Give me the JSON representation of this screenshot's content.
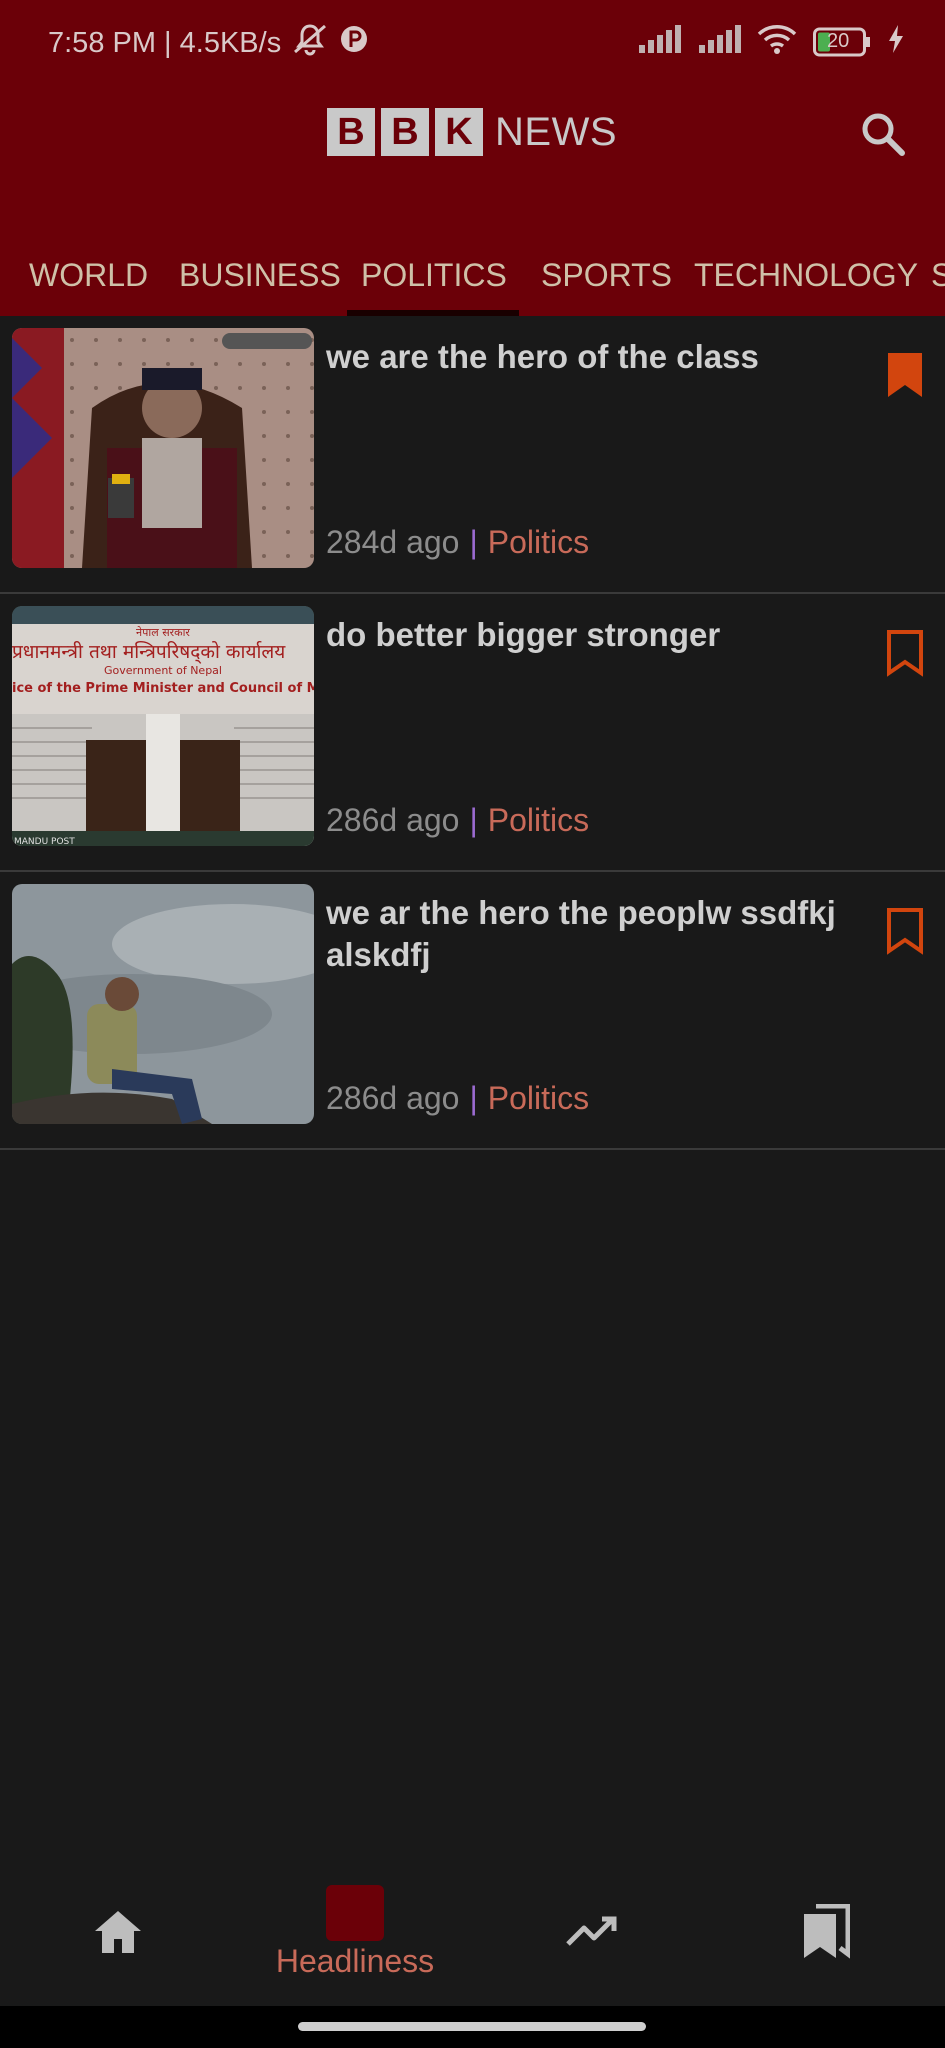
{
  "status_bar": {
    "time": "7:58 PM | 4.5KB/s",
    "battery": "20"
  },
  "header": {
    "brand_letters": [
      "B",
      "B",
      "K"
    ],
    "brand_word": "NEWS",
    "search_icon": "search-icon"
  },
  "tabs": [
    {
      "label": "WORLD"
    },
    {
      "label": "BUSINESS"
    },
    {
      "label": "POLITICS",
      "selected": true
    },
    {
      "label": "SPORTS"
    },
    {
      "label": "TECHNOLOGY"
    },
    {
      "label": "S"
    }
  ],
  "articles": [
    {
      "title": "we are the hero of the class",
      "age": "284d ago",
      "separator": "|",
      "category": "Politics",
      "bookmarked": true
    },
    {
      "title": "do better bigger stronger",
      "age": "286d ago",
      "separator": "|",
      "category": "Politics",
      "bookmarked": false
    },
    {
      "title": "we ar the hero the peoplw ssdfkj alskdfj",
      "age": "286d ago",
      "separator": "|",
      "category": "Politics",
      "bookmarked": false
    }
  ],
  "thumb2": {
    "line1": "नेपाल सरकार",
    "line2": "प्रधानमन्त्री तथा मन्त्रिपरिषद्को कार्यालय",
    "line3": "Government of Nepal",
    "line4": "ice of the Prime Minister and Council of Ministe",
    "credit": "MANDU POST"
  },
  "bottom_nav": {
    "headlines_label": "Headliness"
  },
  "colors": {
    "header_bg": "#6b0008",
    "accent": "#c86a59",
    "bookmark": "#d2450e",
    "page_bg": "#191919"
  }
}
